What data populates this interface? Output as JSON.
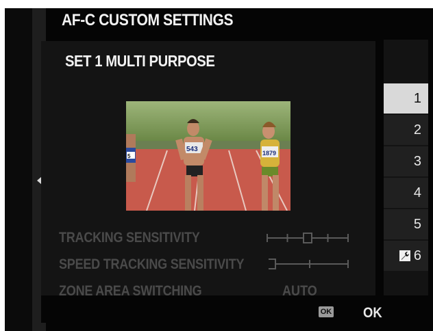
{
  "header": {
    "title": "AF-C CUSTOM SETTINGS"
  },
  "panel": {
    "set_title": "SET 1 MULTI PURPOSE",
    "preview_image": {
      "bib_left": "5",
      "bib_center": "543",
      "bib_right": "1879"
    },
    "settings": {
      "tracking_sensitivity": {
        "label": "TRACKING SENSITIVITY",
        "level": 2,
        "max": 4
      },
      "speed_tracking_sensitivity": {
        "label": "SPEED TRACKING SENSITIVITY",
        "level": 0,
        "max": 2
      },
      "zone_area_switching": {
        "label": "ZONE AREA SWITCHING",
        "value": "AUTO"
      }
    }
  },
  "set_list": {
    "items": [
      {
        "label": "1",
        "selected": true
      },
      {
        "label": "2"
      },
      {
        "label": "3"
      },
      {
        "label": "4"
      },
      {
        "label": "5"
      },
      {
        "label": "6",
        "icon": "custom-edit-icon"
      }
    ]
  },
  "footer": {
    "ok_badge": "OK",
    "ok_label": "OK"
  },
  "colors": {
    "accent_red": "#d0202a",
    "selected_bg": "#d9d9d9",
    "dim_text": "#4a4a4a"
  }
}
